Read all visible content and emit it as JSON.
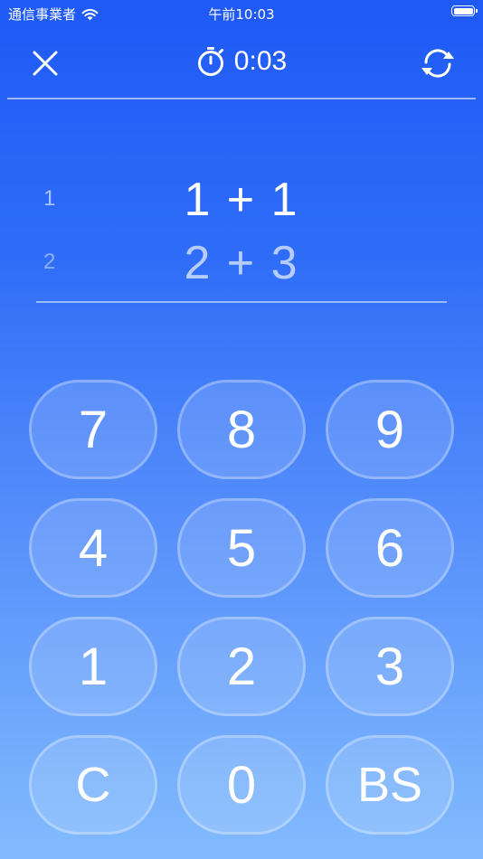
{
  "status_bar": {
    "carrier": "通信事業者",
    "time": "午前10:03"
  },
  "header": {
    "timer": "0:03",
    "close_icon": "close-icon",
    "timer_icon": "stopwatch-icon",
    "restart_icon": "restart-icon"
  },
  "problems": [
    {
      "number": "1",
      "expression": "1 + 1"
    },
    {
      "number": "2",
      "expression": "2 + 3"
    }
  ],
  "keypad": {
    "keys": [
      "7",
      "8",
      "9",
      "4",
      "5",
      "6",
      "1",
      "2",
      "3",
      "C",
      "0",
      "BS"
    ]
  },
  "colors": {
    "gradient_top": "#1f59f6",
    "gradient_bottom": "#82bbfd",
    "text": "#ffffff"
  }
}
